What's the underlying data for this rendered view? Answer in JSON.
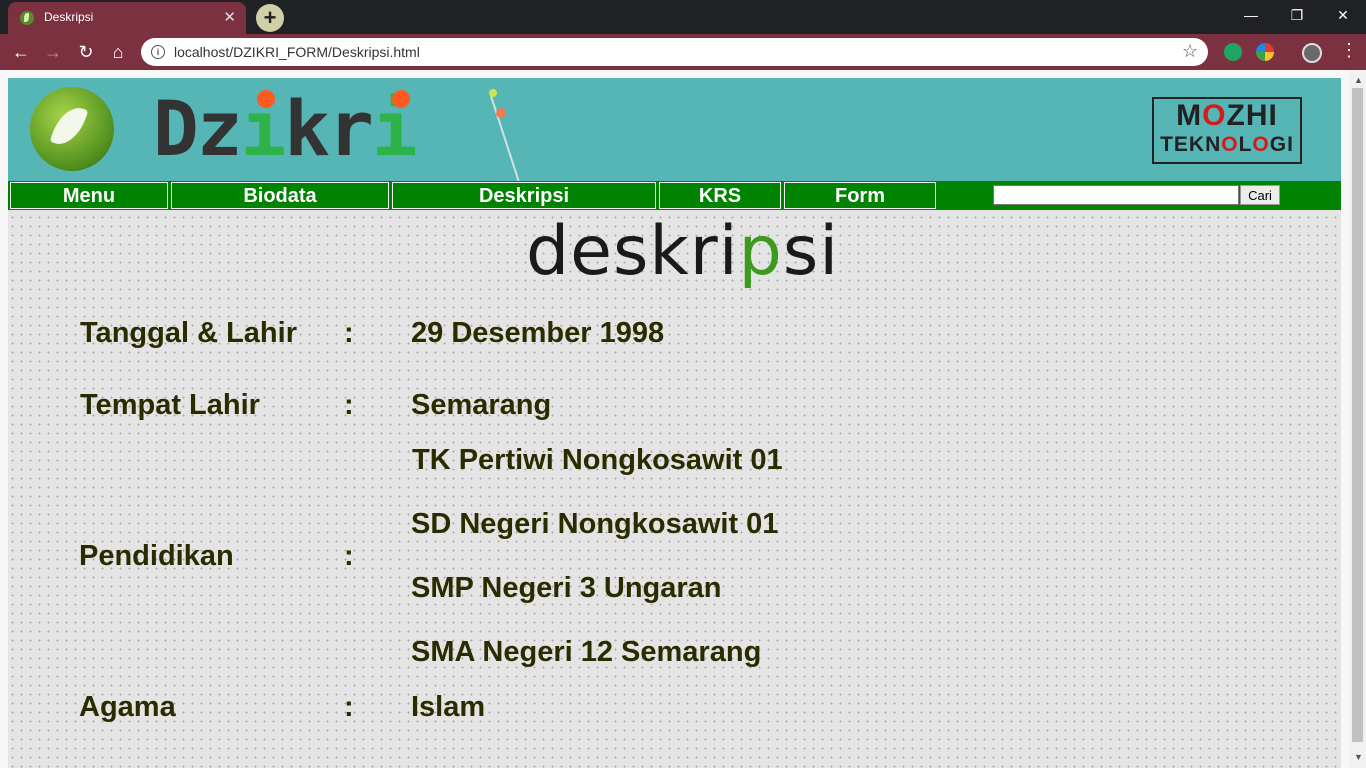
{
  "browser": {
    "tab_title": "Deskripsi",
    "tab_close": "✕",
    "new_tab": "+",
    "url": "localhost/DZIKRI_FORM/Deskripsi.html",
    "back": "←",
    "forward": "→",
    "reload": "↻",
    "home": "⌂",
    "bookmark": "☆",
    "minimize": "—",
    "restore": "❐",
    "close": "✕",
    "menu": "⋮"
  },
  "header": {
    "brand": [
      "Dz",
      "i",
      "kr",
      "i"
    ],
    "partner_line1_a": "M",
    "partner_line1_b": "O",
    "partner_line1_c": "ZHI",
    "partner_line2_a": "TEKN",
    "partner_line2_b": "O",
    "partner_line2_c": "L",
    "partner_line2_d": "O",
    "partner_line2_e": "GI"
  },
  "nav": {
    "items": [
      "Menu",
      "Biodata",
      "Deskripsi",
      "KRS",
      "Form"
    ],
    "search_value": "",
    "search_button": "Cari"
  },
  "content": {
    "title_a": "deskri",
    "title_b": "p",
    "title_c": "si",
    "rows": {
      "tanggal_label": "Tanggal & Lahir",
      "tanggal_value": "29 Desember 1998",
      "tempat_label": "Tempat Lahir",
      "tempat_value": "Semarang",
      "pendidikan_label": "Pendidikan",
      "pendidikan_values": [
        "TK Pertiwi Nongkosawit 01",
        "SD Negeri Nongkosawit 01",
        "SMP Negeri 3 Ungaran",
        "SMA Negeri 12 Semarang"
      ],
      "agama_label": "Agama",
      "agama_value": "Islam",
      "colon": ":"
    }
  },
  "colors": {
    "header_bg": "#55b6b5",
    "nav_bg": "#008300",
    "text": "#2b2b00",
    "browser_accent": "#7b3140"
  }
}
